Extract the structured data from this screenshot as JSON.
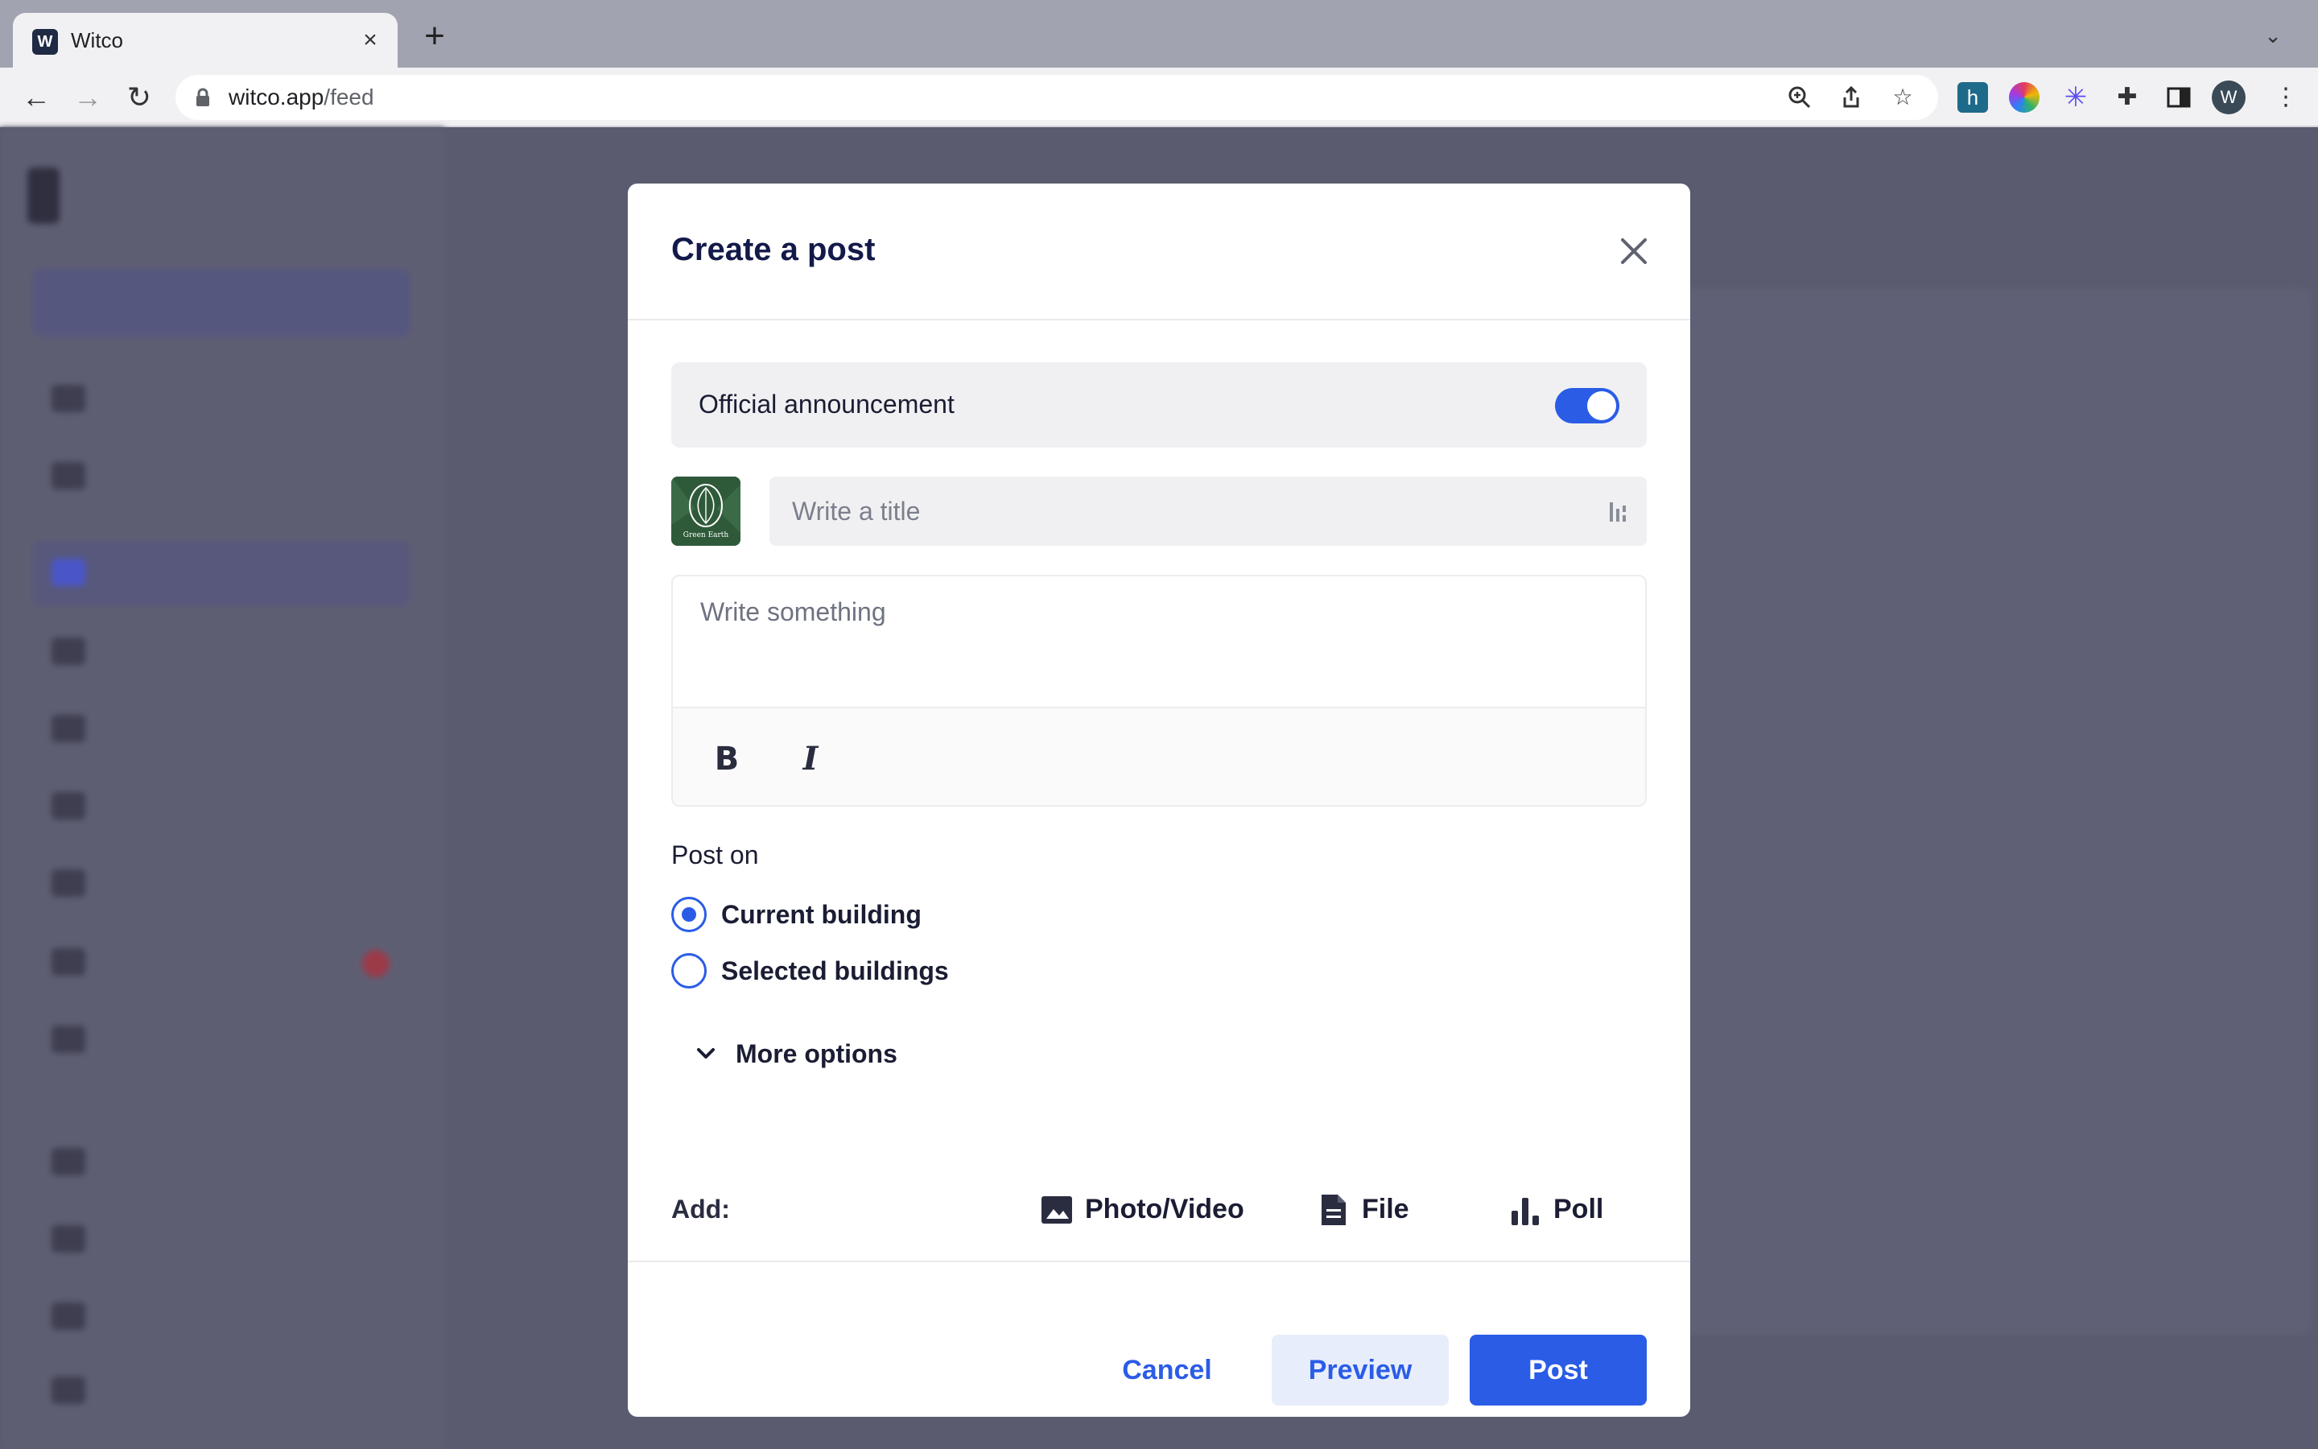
{
  "browser": {
    "tab_title": "Witco",
    "tab_favicon_letter": "W",
    "url_host": "witco.app",
    "url_path": "/feed",
    "profile_initial": "W",
    "icons": [
      "back-icon",
      "forward-icon",
      "reload-icon",
      "lock-icon",
      "zoom-icon",
      "share-icon",
      "bookmark-star-icon",
      "extensions-puzzle-icon",
      "side-panel-icon",
      "kebab-menu-icon"
    ]
  },
  "modal": {
    "title": "Create a post",
    "announcement": {
      "label": "Official announcement",
      "enabled": true
    },
    "org_logo_text": "Green Earth",
    "title_field": {
      "value": "",
      "placeholder": "Write a title"
    },
    "body_field": {
      "value": "",
      "placeholder": "Write something"
    },
    "formatting": {
      "bold": "B",
      "italic": "I"
    },
    "post_on": {
      "label": "Post on",
      "options": [
        {
          "label": "Current building",
          "checked": true
        },
        {
          "label": "Selected buildings",
          "checked": false
        }
      ]
    },
    "more_options_label": "More options",
    "add": {
      "label": "Add:",
      "photo_video": "Photo/Video",
      "file": "File",
      "poll": "Poll"
    },
    "footer": {
      "cancel": "Cancel",
      "preview": "Preview",
      "post": "Post"
    }
  },
  "colors": {
    "accent": "#2a5ce6",
    "title_text": "#131a4a",
    "overlay": "#5a5a6e"
  }
}
